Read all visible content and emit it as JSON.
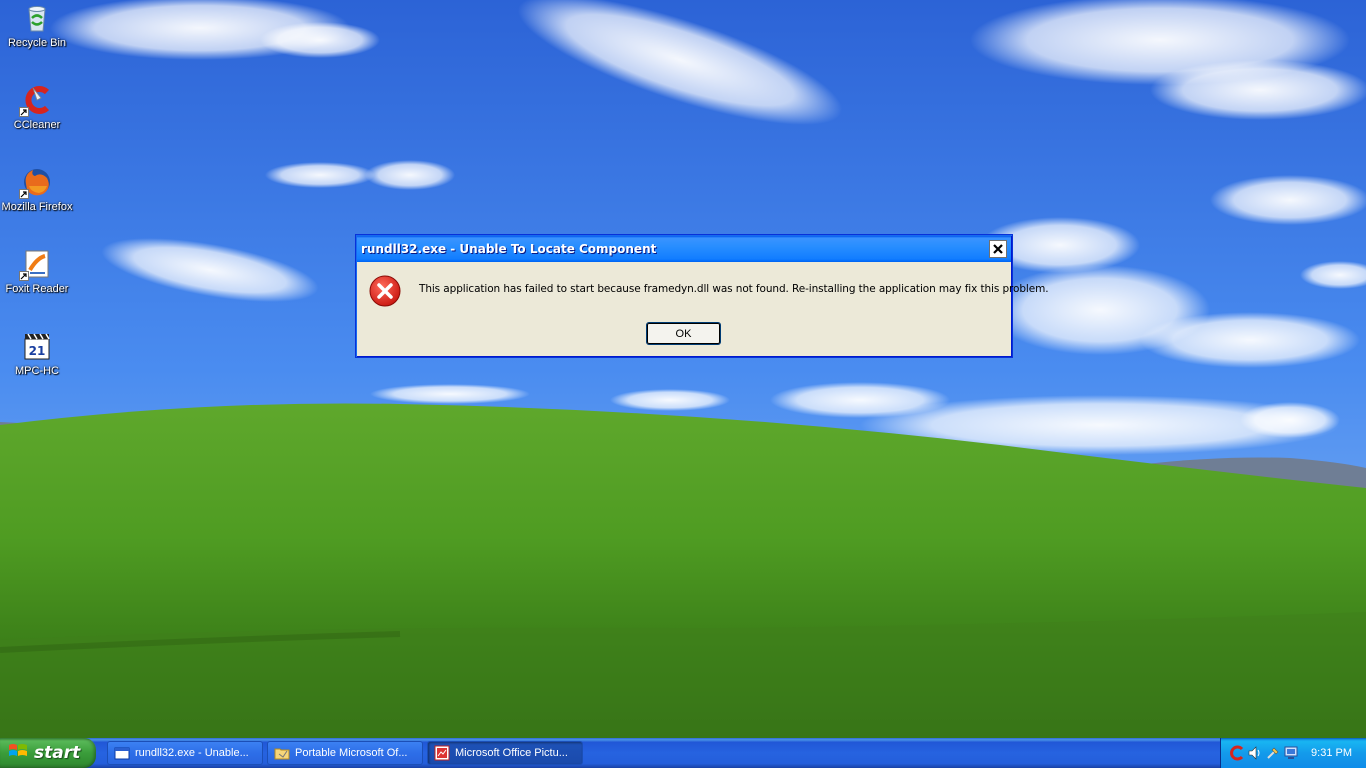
{
  "desktop": {
    "icons": [
      {
        "label": "Recycle Bin",
        "icon": "recycle-bin-icon"
      },
      {
        "label": "CCleaner",
        "icon": "ccleaner-icon"
      },
      {
        "label": "Mozilla Firefox",
        "icon": "firefox-icon"
      },
      {
        "label": "Foxit Reader",
        "icon": "foxit-reader-icon"
      },
      {
        "label": "MPC-HC",
        "icon": "mpc-hc-icon"
      }
    ]
  },
  "dialog": {
    "title": "rundll32.exe - Unable To Locate Component",
    "message": "This application has failed to start because framedyn.dll was not found. Re-installing the application may fix this problem.",
    "ok_label": "OK",
    "icon": "error-icon"
  },
  "taskbar": {
    "start_label": "start",
    "tasks": [
      {
        "label": "rundll32.exe - Unable...",
        "icon": "window-icon",
        "active": false
      },
      {
        "label": "Portable Microsoft Of...",
        "icon": "folder-icon",
        "active": false
      },
      {
        "label": "Microsoft Office Pictu...",
        "icon": "office-picture-icon",
        "active": true
      }
    ],
    "clock": "9:31 PM"
  },
  "colors": {
    "titlebar": "#0058ee",
    "dialog_bg": "#ece9d8",
    "taskbar": "#245edb",
    "start_button": "#3a9d3a"
  }
}
